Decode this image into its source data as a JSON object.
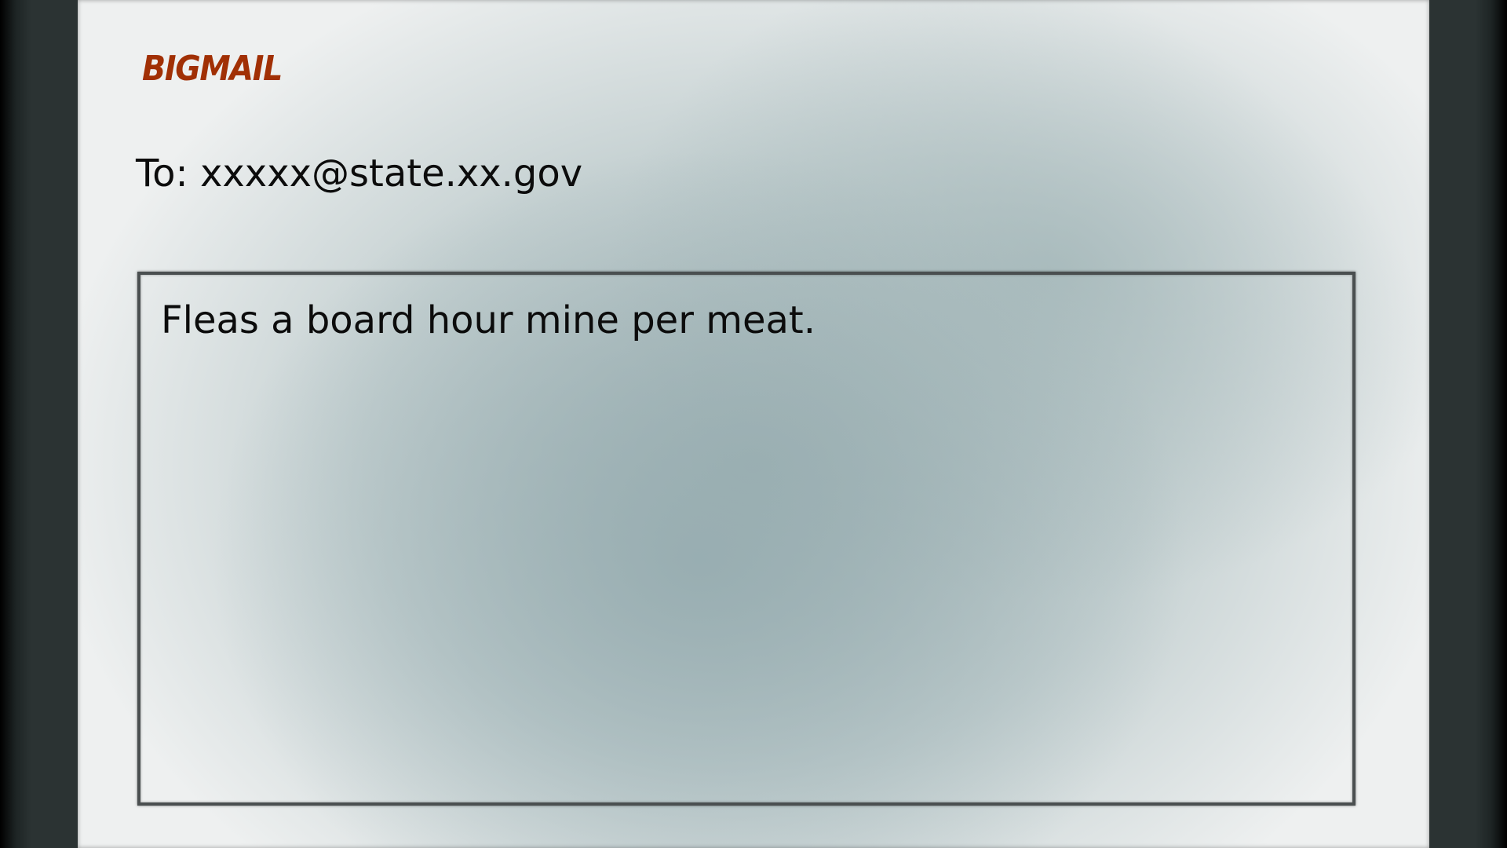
{
  "app": {
    "logo_text": "BIGMAIL"
  },
  "compose": {
    "to_label": "To:",
    "to_address": "xxxxx@state.xx.gov",
    "body_text": "Fleas a board hour mine per meat."
  },
  "colors": {
    "logo": "#a13005",
    "text": "#0c0c0c",
    "frame": "#2b3333",
    "box_border": "#4a4f50"
  }
}
